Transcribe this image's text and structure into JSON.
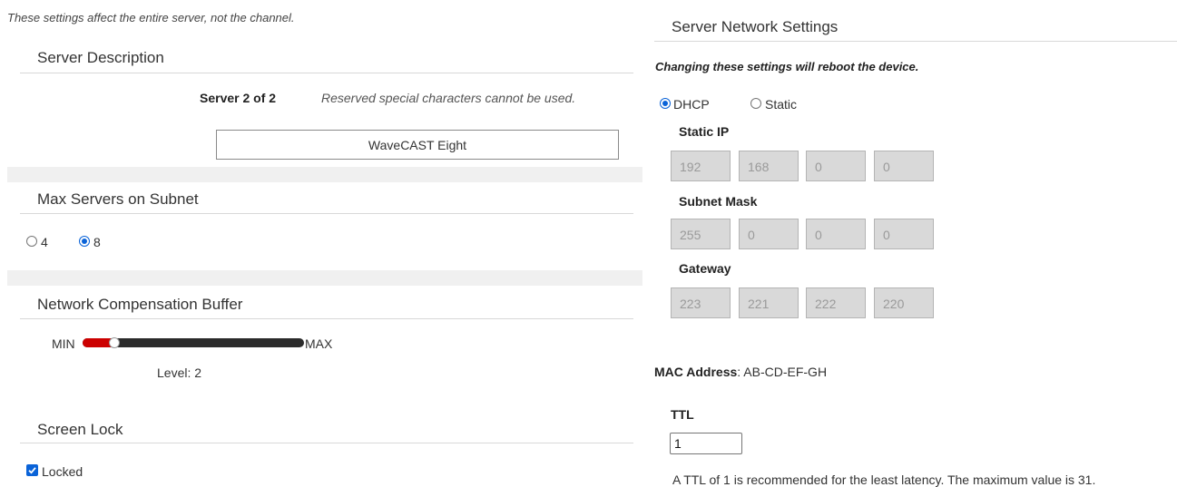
{
  "left": {
    "intro": "These settings affect the entire server, not the channel.",
    "server_description": {
      "heading": "Server Description",
      "server_count": "Server 2 of 2",
      "notice": "Reserved special characters cannot be used.",
      "name_value": "WaveCAST Eight"
    },
    "max_servers": {
      "heading": "Max Servers on Subnet",
      "options": [
        "4",
        "8"
      ],
      "selected": "8"
    },
    "buffer": {
      "heading": "Network Compensation Buffer",
      "min_label": "MIN",
      "max_label": "MAX",
      "level_text": "Level: 2",
      "level_fraction": 0.12
    },
    "screen_lock": {
      "heading": "Screen Lock",
      "checkbox_label": "Locked",
      "checked": true
    }
  },
  "right": {
    "heading": "Server Network Settings",
    "warning": "Changing these settings will reboot the device.",
    "mode_options": [
      "DHCP",
      "Static"
    ],
    "mode_selected": "DHCP",
    "static_ip": {
      "label": "Static IP",
      "octets": [
        "192",
        "168",
        "0",
        "0"
      ]
    },
    "subnet_mask": {
      "label": "Subnet Mask",
      "octets": [
        "255",
        "0",
        "0",
        "0"
      ]
    },
    "gateway": {
      "label": "Gateway",
      "octets": [
        "223",
        "221",
        "222",
        "220"
      ]
    },
    "mac": {
      "label": "MAC Address",
      "value": ": AB-CD-EF-GH"
    },
    "ttl": {
      "label": "TTL",
      "value": "1",
      "help": "A TTL of 1 is recommended for the least latency. The maximum value is 31."
    }
  },
  "colors": {
    "accent_blue": "#0a63d8",
    "slider_red": "#cc0000",
    "slider_track": "#2b2b2b"
  }
}
